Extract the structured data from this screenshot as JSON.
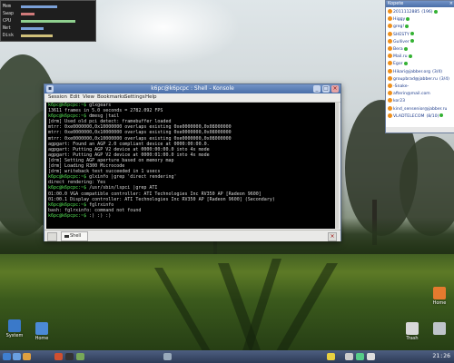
{
  "colors": {
    "titlebar_top": "#7394c7",
    "titlebar_bottom": "#4a6ea8",
    "prompt": "#54e354",
    "terminal_bg": "#000000",
    "contact_text": "#1b3a8a",
    "status_online": "#34b233",
    "taskbar": "#2d3b57"
  },
  "system_monitor": {
    "rows": [
      "Mem",
      "Swap",
      "CPU",
      "Net",
      "Disk"
    ]
  },
  "konsole": {
    "title": "k6pc@k6pcpc : Shell - Konsole",
    "menu": [
      "Session",
      "Edit",
      "View",
      "Bookmarks",
      "Settings",
      "Help"
    ],
    "lines": [
      {
        "prompt": "k6pc@k6pcpc:~$ ",
        "text": "glxgears"
      },
      {
        "prompt": "",
        "text": "13611 frames in 5.0 seconds = 2782.092 FPS"
      },
      {
        "prompt": "k6pc@k6pcpc:~$ ",
        "text": "dmesg |tail"
      },
      {
        "prompt": "",
        "text": "[drm] Used old pci detect: framebuffer loaded"
      },
      {
        "prompt": "",
        "text": "mtrr: 0xe0000000,0x10000000 overlaps existing 0xe0000000,0x08000000"
      },
      {
        "prompt": "",
        "text": "mtrr: 0xe0000000,0x10000000 overlaps existing 0xe0000000,0x08000000"
      },
      {
        "prompt": "",
        "text": "mtrr: 0xe0000000,0x10000000 overlaps existing 0xe0000000,0x08000000"
      },
      {
        "prompt": "",
        "text": "agpgart: Found an AGP 2.0 compliant device at 0000:00:00.0."
      },
      {
        "prompt": "",
        "text": "agpgart: Putting AGP V2 device at 0000:00:00.0 into 4x mode"
      },
      {
        "prompt": "",
        "text": "agpgart: Putting AGP V2 device at 0000:01:00.0 into 4x mode"
      },
      {
        "prompt": "",
        "text": "[drm] Setting AGP aperture based on memory map"
      },
      {
        "prompt": "",
        "text": "[drm] Loading R300 Microcode"
      },
      {
        "prompt": "",
        "text": "[drm] writeback test succeeded in 1 usecs"
      },
      {
        "prompt": "k6pc@k6pcpc:~$ ",
        "text": "glxinfo |grep 'direct rendering'"
      },
      {
        "prompt": "",
        "text": "direct rendering: Yes"
      },
      {
        "prompt": "k6pc@k6pcpc:~$ ",
        "text": "/usr/sbin/lspci |grep ATI"
      },
      {
        "prompt": "",
        "text": "01:00.0 VGA compatible controller: ATI Technologies Inc RV350 AP [Radeon 9600]"
      },
      {
        "prompt": "",
        "text": "01:00.1 Display controller: ATI Technologies Inc RV350 AP [Radeon 9600] (Secondary)"
      },
      {
        "prompt": "k6pc@k6pcpc:~$ ",
        "text": "fglrxinfo"
      },
      {
        "prompt": "",
        "text": "bash: fglrxinfo: command not found"
      },
      {
        "prompt": "k6pc@k6pcpc:~$ ",
        "text": ":) :) :) "
      }
    ],
    "tab_label": "Shell"
  },
  "kopete": {
    "title": "Kopete",
    "contacts": [
      {
        "name": "2011112885",
        "extra": "(196)"
      },
      {
        "name": "Higgy",
        "extra": ""
      },
      {
        "name": "greg!",
        "extra": ""
      },
      {
        "name": "SHESTY",
        "extra": ""
      },
      {
        "name": "Gulliver",
        "extra": ""
      },
      {
        "name": "Bera",
        "extra": ""
      },
      {
        "name": "Mail.ru",
        "extra": ""
      },
      {
        "name": "Egor",
        "extra": ""
      },
      {
        "name": "Hikari@jabber.org",
        "extra": "(3/4)"
      },
      {
        "name": "groupbrad@jabber.ru",
        "extra": "(3/4)"
      },
      {
        "name": "-Snake-",
        "extra": ""
      },
      {
        "name": "afterin@mail.com",
        "extra": ""
      },
      {
        "name": "kor23",
        "extra": ""
      },
      {
        "name": "kind_sensenior@jabber.ru",
        "extra": ""
      },
      {
        "name": "VLADTELECOM",
        "extra": "(8/10)"
      }
    ]
  },
  "desktop_icons": [
    {
      "label": "System",
      "color": "#3a79c9"
    },
    {
      "label": "Home",
      "color": "#4b8ad6"
    },
    {
      "label": "Trash",
      "color": "#d8d8d8"
    },
    {
      "label": "Home",
      "color": "#e47a2e"
    }
  ],
  "taskbar": {
    "icons": [
      "kmenu-icon",
      "desktop-icon",
      "home-icon",
      "browser-icon",
      "konsole-icon",
      "editor-icon",
      "pager-icon",
      "kopete-icon",
      "volume-icon",
      "network-icon",
      "tray-icon"
    ],
    "clock": "21:26"
  }
}
